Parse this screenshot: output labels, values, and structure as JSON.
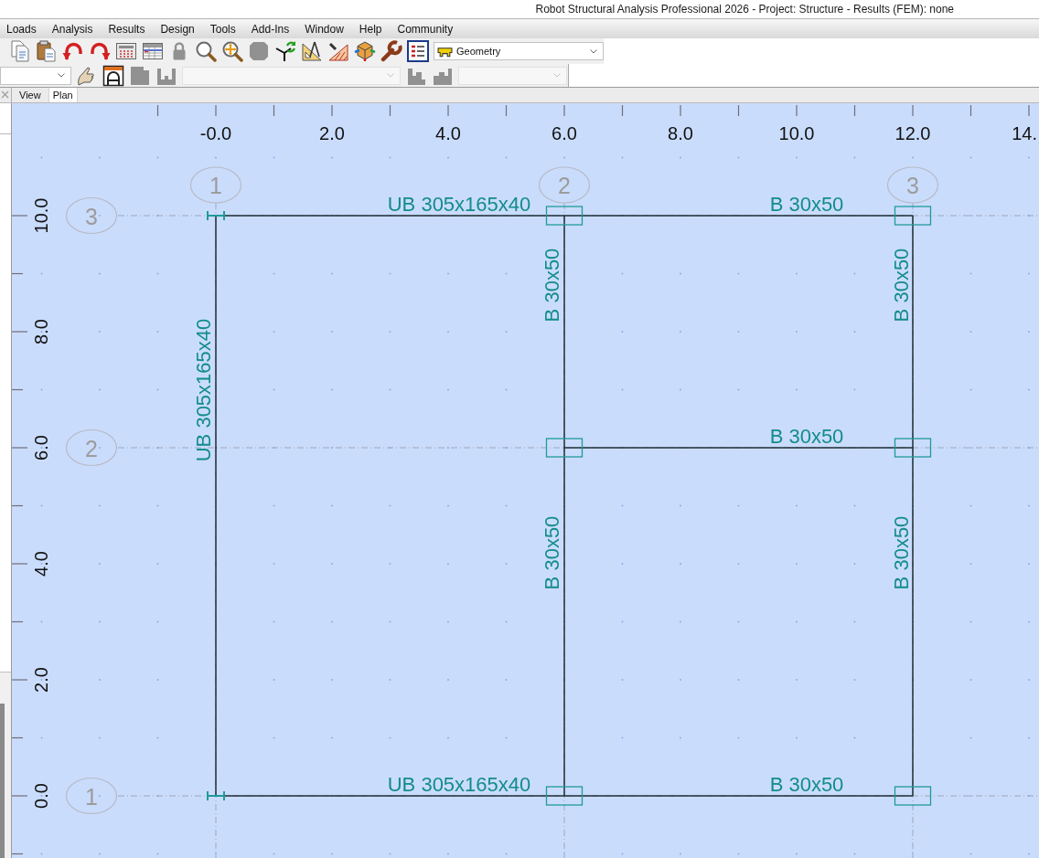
{
  "window": {
    "title": "Robot Structural Analysis Professional 2026 - Project: Structure - Results (FEM): none"
  },
  "menu": [
    "Loads",
    "Analysis",
    "Results",
    "Design",
    "Tools",
    "Add-Ins",
    "Window",
    "Help",
    "Community"
  ],
  "toolbar": {
    "rows": [
      [
        {
          "kind": "button",
          "disabled": false
        },
        {
          "kind": "button",
          "disabled": false
        },
        {
          "kind": "button",
          "disabled": false
        },
        {
          "kind": "button",
          "disabled": false
        },
        {
          "kind": "button",
          "disabled": false
        },
        {
          "kind": "button",
          "disabled": false
        },
        {
          "kind": "button",
          "disabled": true
        },
        {
          "kind": "button",
          "disabled": false
        },
        {
          "kind": "button",
          "disabled": false
        },
        {
          "kind": "button",
          "disabled": true
        },
        {
          "kind": "button",
          "disabled": false
        },
        {
          "kind": "button",
          "disabled": false
        },
        {
          "kind": "button",
          "disabled": false
        },
        {
          "kind": "button",
          "disabled": false
        },
        {
          "kind": "button",
          "disabled": false
        },
        {
          "kind": "button",
          "disabled": false
        },
        {
          "kind": "dropdown",
          "value": "Geometry",
          "disabled": false
        }
      ],
      [
        {
          "kind": "dropdown",
          "disabled": false
        },
        {
          "kind": "button",
          "disabled": false
        },
        {
          "kind": "button",
          "disabled": false
        },
        {
          "kind": "button",
          "disabled": true
        },
        {
          "kind": "button",
          "disabled": true
        },
        {
          "kind": "dropdown",
          "disabled": true
        },
        {
          "kind": "button",
          "disabled": true
        },
        {
          "kind": "button",
          "disabled": true
        },
        {
          "kind": "dropdown",
          "disabled": true
        }
      ]
    ]
  },
  "tabs": [
    {
      "label": "View",
      "selected": false
    },
    {
      "label": "Plan",
      "selected": true
    }
  ],
  "plan": {
    "x_ruler": [
      "-0.0",
      "2.0",
      "4.0",
      "6.0",
      "8.0",
      "10.0",
      "12.0",
      "14."
    ],
    "y_ruler": [
      "10.0",
      "8.0",
      "6.0",
      "4.0",
      "2.0",
      "0.0"
    ],
    "x_axes": [
      "1",
      "2",
      "3"
    ],
    "y_axes": [
      "3",
      "2",
      "1"
    ],
    "members": [
      {
        "label": "UB 305x165x40"
      },
      {
        "label": "B 30x50"
      },
      {
        "label": "B 30x50"
      },
      {
        "label": "B 30x50"
      },
      {
        "label": "UB 305x165x40"
      },
      {
        "label": "B 30x50"
      },
      {
        "label": "B 30x50"
      },
      {
        "label": "B 30x50"
      },
      {
        "label": "UB 305x165x40"
      },
      {
        "label": "B 30x50"
      }
    ]
  }
}
